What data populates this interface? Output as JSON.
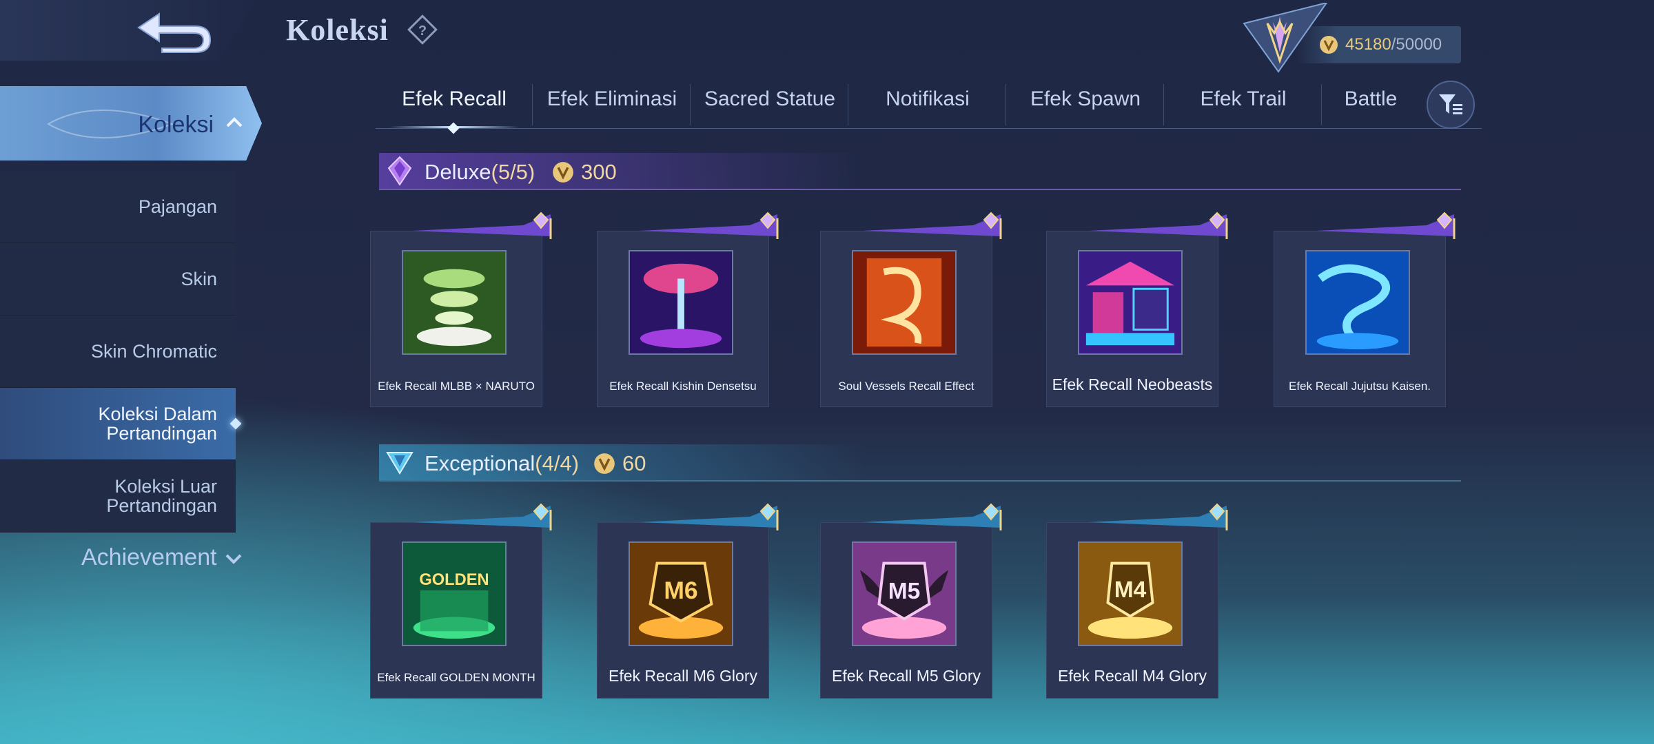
{
  "header": {
    "title": "Koleksi",
    "currency_value": "45180",
    "currency_max": "/50000"
  },
  "sidebar": {
    "main": "Koleksi",
    "items": [
      {
        "label": "Pajangan"
      },
      {
        "label": "Skin"
      },
      {
        "label": "Skin Chromatic"
      },
      {
        "label": "Koleksi Dalam Pertandingan"
      },
      {
        "label": "Koleksi Luar Pertandingan"
      }
    ],
    "footer": "Achievement"
  },
  "tabs": [
    "Efek Recall",
    "Efek Eliminasi",
    "Sacred Statue",
    "Notifikasi",
    "Efek Spawn",
    "Efek Trail",
    "Battle"
  ],
  "sections": [
    {
      "name": "Deluxe",
      "count": "(5/5)",
      "price": "300",
      "color": "#8a5be0",
      "items": [
        {
          "name": "Efek Recall MLBB × NARUTO",
          "art": "green-tornado"
        },
        {
          "name": "Efek Recall Kishin Densetsu",
          "art": "sakura-light"
        },
        {
          "name": "Soul Vessels Recall Effect",
          "art": "fire-dragon"
        },
        {
          "name": "Efek Recall Neobeasts",
          "art": "neon-shop"
        },
        {
          "name": "Efek Recall Jujutsu Kaisen.",
          "art": "blue-curse"
        }
      ]
    },
    {
      "name": "Exceptional",
      "count": "(4/4)",
      "price": "60",
      "color": "#4aa9d8",
      "items": [
        {
          "name": "Efek Recall GOLDEN MONTH",
          "art": "golden-month",
          "badge": "GOLDEN"
        },
        {
          "name": "Efek Recall M6 Glory",
          "art": "m-glory",
          "badge": "M6"
        },
        {
          "name": "Efek Recall M5 Glory",
          "art": "m-glory",
          "badge": "M5"
        },
        {
          "name": "Efek Recall M4 Glory",
          "art": "m-glory",
          "badge": "M4"
        }
      ]
    }
  ]
}
